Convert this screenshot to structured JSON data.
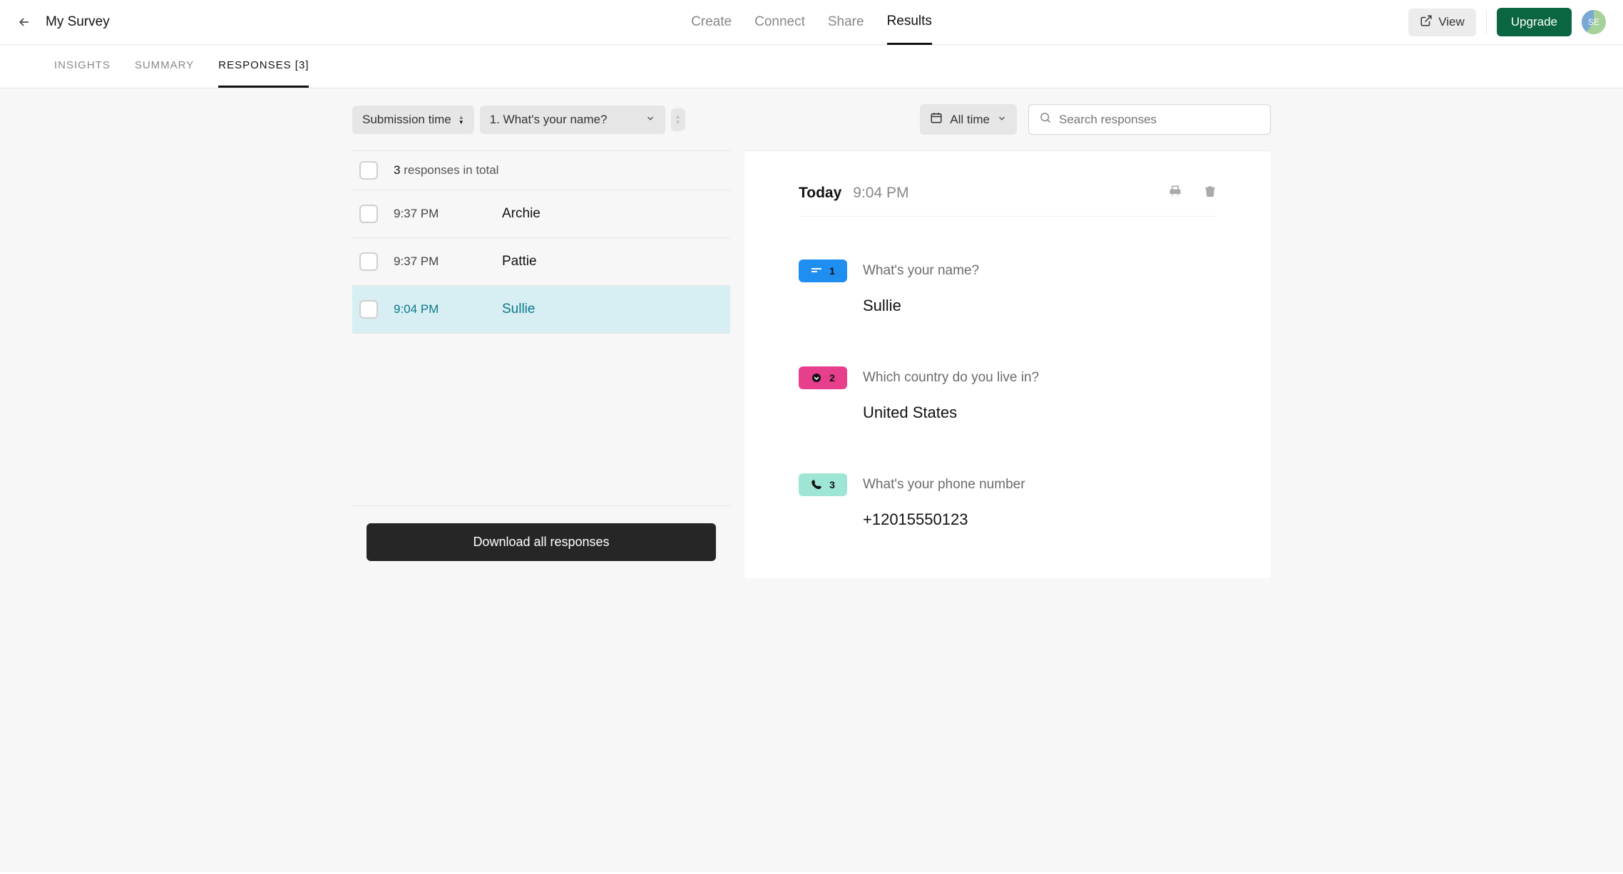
{
  "header": {
    "title": "My Survey",
    "nav": {
      "create": "Create",
      "connect": "Connect",
      "share": "Share",
      "results": "Results"
    },
    "view_label": "View",
    "upgrade_label": "Upgrade",
    "avatar_initials": "SE"
  },
  "subtabs": {
    "insights": "INSIGHTS",
    "summary": "SUMMARY",
    "responses": "RESPONSES [3]"
  },
  "filters": {
    "sort_label": "Submission time",
    "question_label": "1. What's your name?",
    "time_label": "All time",
    "search_placeholder": "Search responses"
  },
  "list": {
    "count": "3",
    "count_suffix": "responses in total",
    "rows": [
      {
        "time": "9:37 PM",
        "name": "Archie"
      },
      {
        "time": "9:37 PM",
        "name": "Pattie"
      },
      {
        "time": "9:04 PM",
        "name": "Sullie"
      }
    ],
    "download_label": "Download all responses"
  },
  "detail": {
    "day": "Today",
    "time": "9:04 PM",
    "qa": [
      {
        "num": "1",
        "question": "What's your name?",
        "answer": "Sullie"
      },
      {
        "num": "2",
        "question": "Which country do you live in?",
        "answer": "United States"
      },
      {
        "num": "3",
        "question": "What's your phone number",
        "answer": "+12015550123"
      }
    ]
  }
}
